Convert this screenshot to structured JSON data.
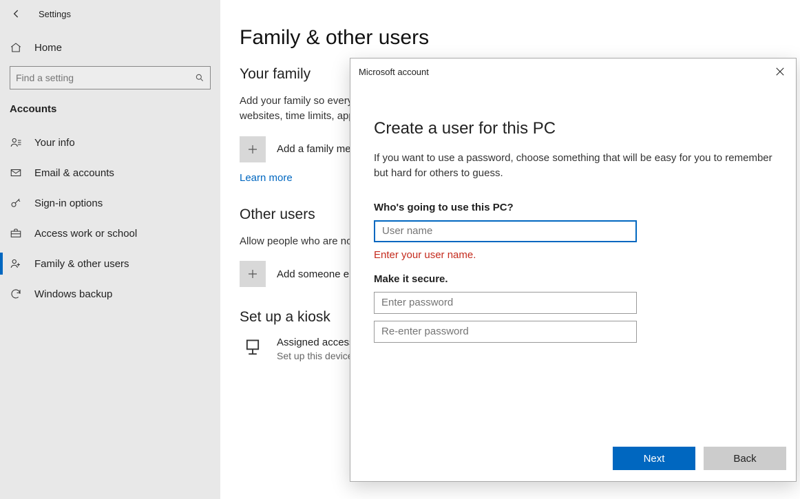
{
  "window_title": "Settings",
  "home_label": "Home",
  "search_placeholder": "Find a setting",
  "category": "Accounts",
  "nav": [
    {
      "icon": "user",
      "label": "Your info"
    },
    {
      "icon": "mail",
      "label": "Email & accounts"
    },
    {
      "icon": "key",
      "label": "Sign-in options"
    },
    {
      "icon": "briefcase",
      "label": "Access work or school"
    },
    {
      "icon": "family",
      "label": "Family & other users",
      "selected": true
    },
    {
      "icon": "sync",
      "label": "Windows backup"
    }
  ],
  "page": {
    "title": "Family & other users",
    "family": {
      "heading": "Your family",
      "desc": "Add your family so everybody gets their own sign-in and desktop. You can help kids stay safe with appropriate websites, time limits, apps, and games.",
      "add_label": "Add a family member",
      "learn_more": "Learn more"
    },
    "other": {
      "heading": "Other users",
      "desc": "Allow people who are not part of your family to sign in with their own accounts. This won't add them to your family.",
      "add_label": "Add someone else to this PC"
    },
    "kiosk": {
      "heading": "Set up a kiosk",
      "item_title": "Assigned access",
      "item_desc": "Set up this device as a kiosk — this could be a digital sign, interactive display, or public browser among other things."
    }
  },
  "dialog": {
    "titlebar": "Microsoft account",
    "heading": "Create a user for this PC",
    "desc": "If you want to use a password, choose something that will be easy for you to remember but hard for others to guess.",
    "question1": "Who's going to use this PC?",
    "username_placeholder": "User name",
    "username_value": "",
    "error": "Enter your user name.",
    "question2": "Make it secure.",
    "password_placeholder": "Enter password",
    "password_value": "",
    "password2_placeholder": "Re-enter password",
    "password2_value": "",
    "next": "Next",
    "back": "Back"
  }
}
